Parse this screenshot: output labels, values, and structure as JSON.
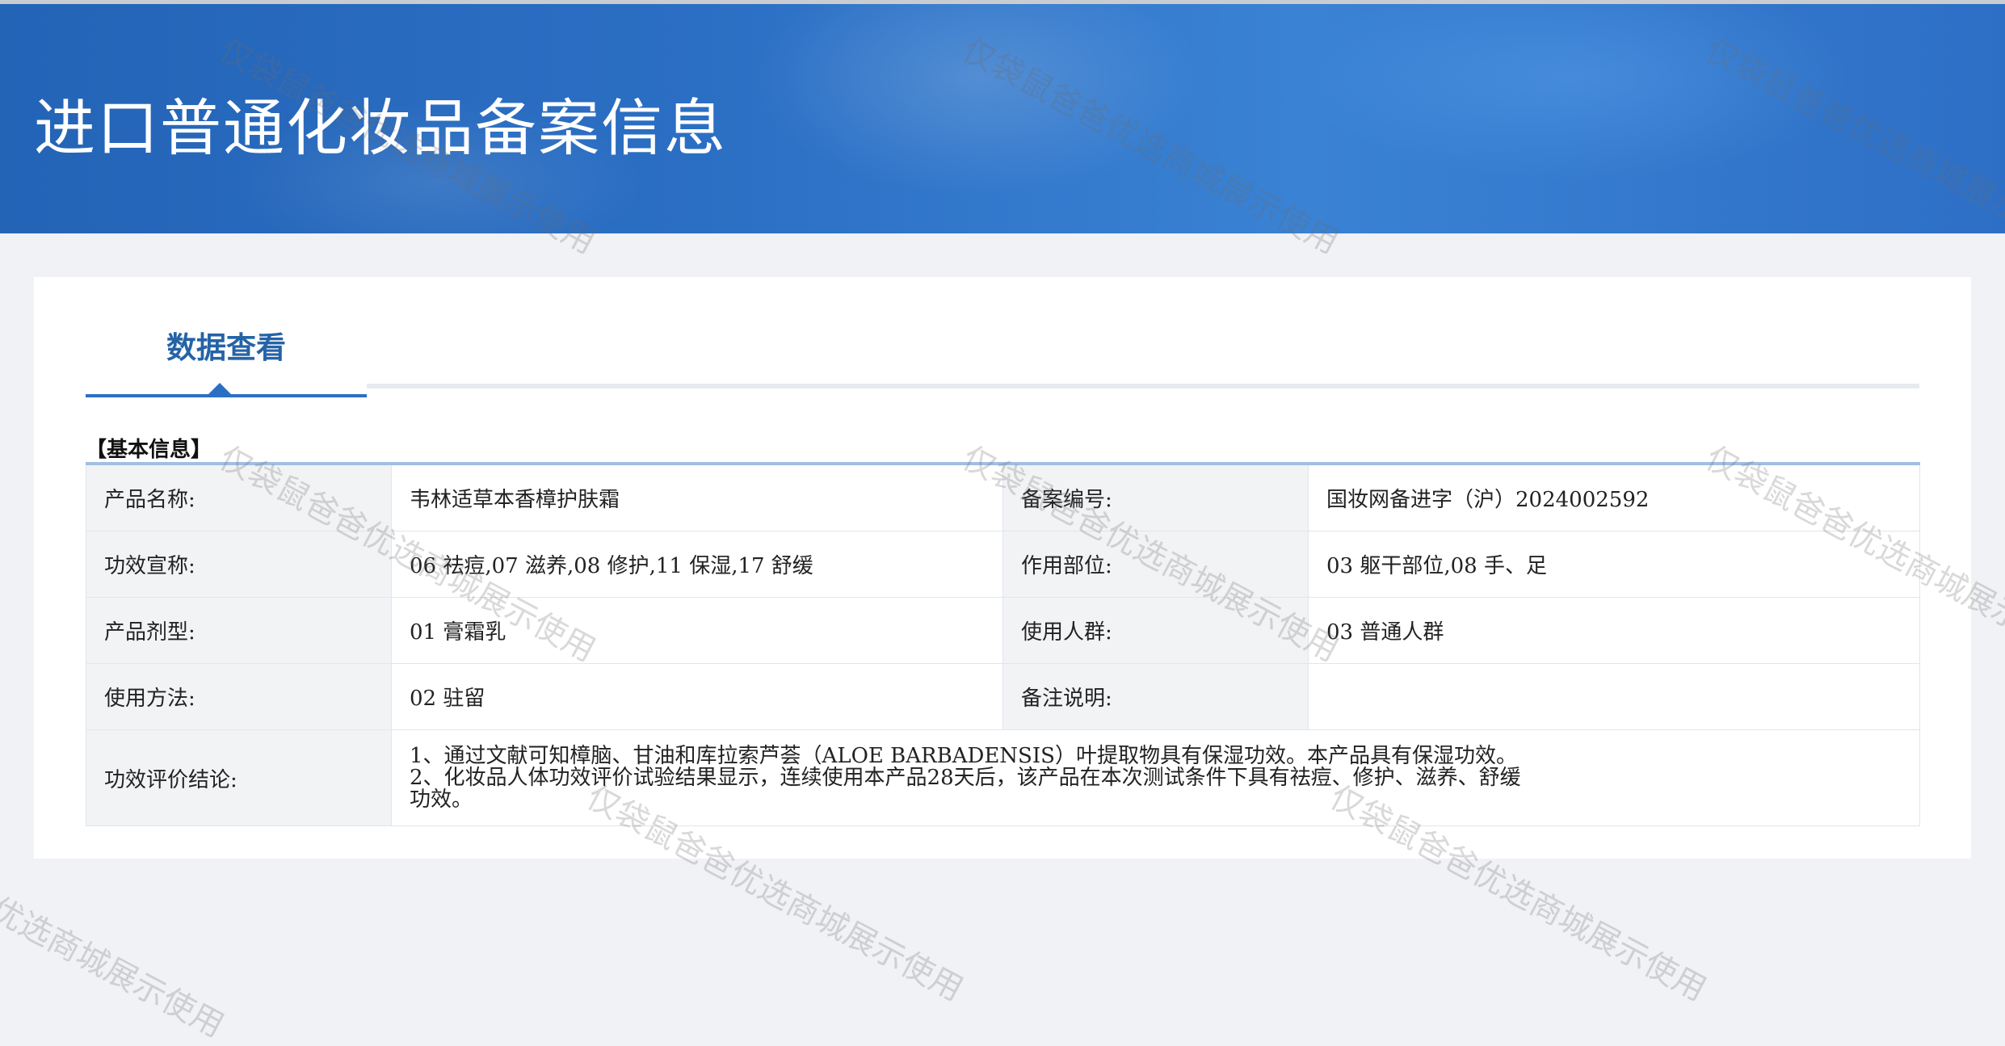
{
  "header": {
    "title": "进口普通化妆品备案信息"
  },
  "tabs": [
    {
      "label": "数据查看",
      "active": true
    }
  ],
  "section": {
    "title": "【基本信息】"
  },
  "rows": [
    {
      "label1": "产品名称:",
      "value1": "韦林适草本香樟护肤霜",
      "label2": "备案编号:",
      "value2": "国妆网备进字（沪）2024002592"
    },
    {
      "label1": "功效宣称:",
      "value1": "06 祛痘,07 滋养,08 修护,11 保湿,17 舒缓",
      "label2": "作用部位:",
      "value2": "03 躯干部位,08 手、足"
    },
    {
      "label1": "产品剂型:",
      "value1": "01 膏霜乳",
      "label2": "使用人群:",
      "value2": "03 普通人群"
    },
    {
      "label1": "使用方法:",
      "value1": "02 驻留",
      "label2": "备注说明:",
      "value2": ""
    }
  ],
  "conclusion": {
    "label": "功效评价结论:",
    "lines": [
      "1、通过文献可知樟脑、甘油和库拉索芦荟（ALOE BARBADENSIS）叶提取物具有保湿功效。本产品具有保湿功效。",
      "2、化妆品人体功效评价试验结果显示，连续使用本产品28天后，该产品在本次测试条件下具有祛痘、修护、滋养、舒缓",
      "功效。"
    ]
  },
  "watermarks": [
    "仅袋鼠爸爸优选商城展示使用",
    "仅袋鼠爸爸优选商城展示使用",
    "仅袋鼠爸爸优选商城展示使用",
    "仅袋鼠爸爸优选商城展示使用",
    "仅袋鼠爸爸优选商城展示使用",
    "仅袋鼠爸爸优选商城展示使用",
    "仅袋鼠爸爸优选商城展示使用",
    "仅袋鼠爸爸优选商城展示使用",
    "仅袋鼠爸爸优选商城展示使用"
  ],
  "colors": {
    "banner": "#2b6fc4",
    "accent": "#2563a6",
    "label_bg": "#f2f3f5",
    "table_top": "#9fbfe3"
  }
}
